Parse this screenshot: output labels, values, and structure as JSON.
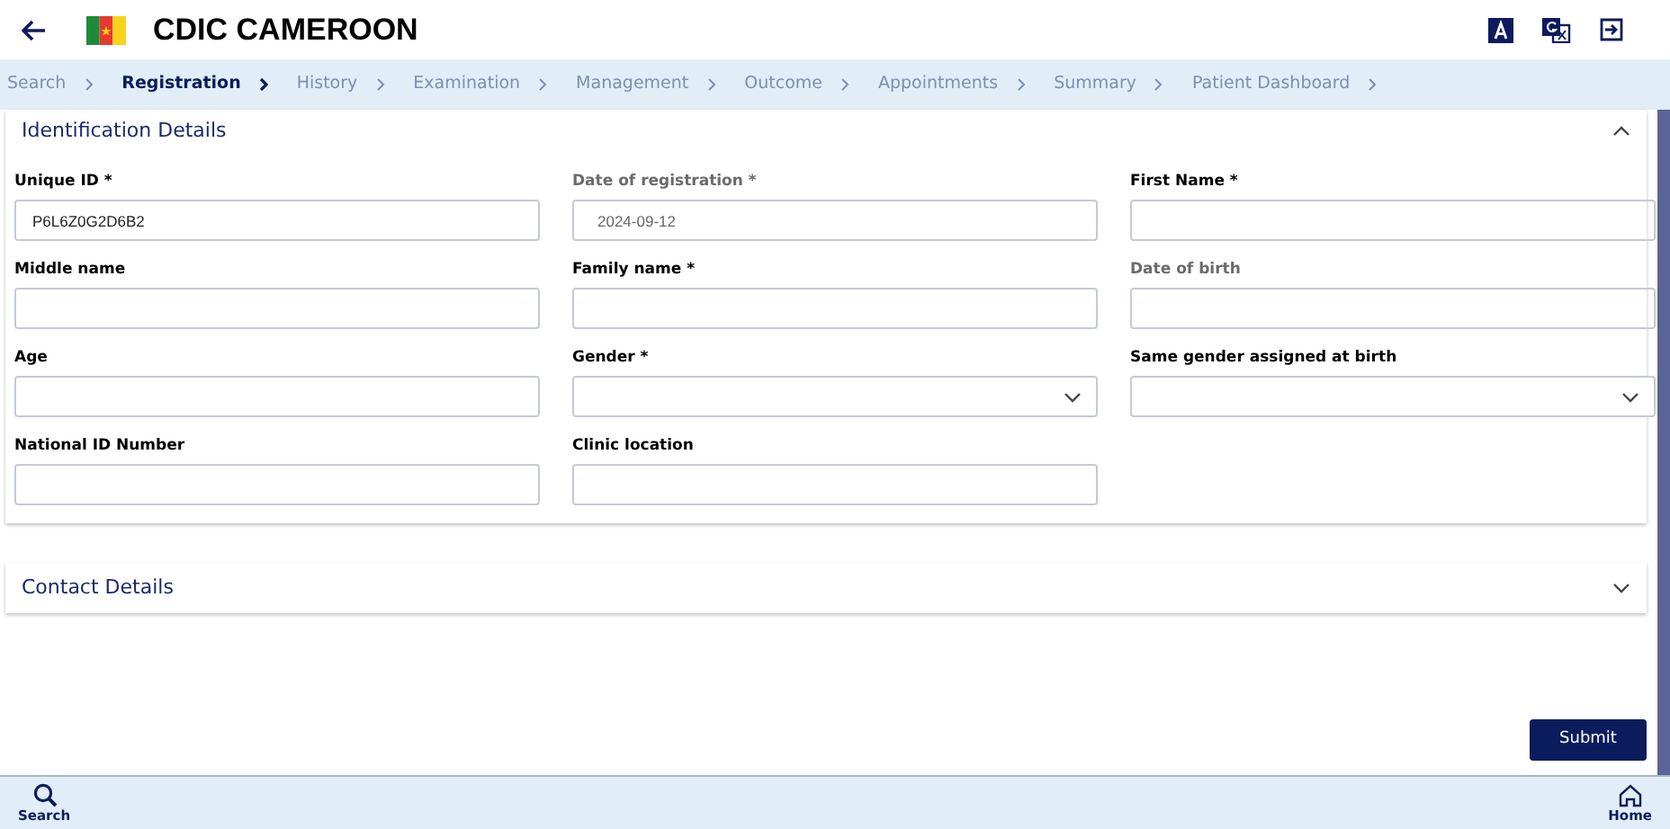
{
  "app_bar": {
    "title": "CDIC CAMEROON"
  },
  "breadcrumbs": [
    {
      "label": "Search",
      "selected": false
    },
    {
      "label": "Registration",
      "selected": true
    },
    {
      "label": "History",
      "selected": false
    },
    {
      "label": "Examination",
      "selected": false
    },
    {
      "label": "Management",
      "selected": false
    },
    {
      "label": "Outcome",
      "selected": false
    },
    {
      "label": "Appointments",
      "selected": false
    },
    {
      "label": "Summary",
      "selected": false
    },
    {
      "label": "Patient Dashboard",
      "selected": false
    }
  ],
  "sections": [
    {
      "title": "Identification Details",
      "expanded": true,
      "fields": [
        {
          "label": "Unique ID *",
          "kind": "text",
          "value": "P6L6Z0G2D6B2",
          "disabled": false
        },
        {
          "label": "Date of registration *",
          "kind": "text",
          "value": "2024-09-12",
          "disabled": true
        },
        {
          "label": "First Name *",
          "kind": "text",
          "disabled": false
        },
        {
          "label": "Middle name",
          "kind": "text",
          "disabled": false
        },
        {
          "label": "Family name *",
          "kind": "text",
          "disabled": false
        },
        {
          "label": "Date of birth",
          "kind": "text",
          "disabled": true
        },
        {
          "label": "Age",
          "kind": "text",
          "disabled": false
        },
        {
          "label": "Gender *",
          "kind": "select",
          "disabled": false
        },
        {
          "label": "Same gender assigned at birth",
          "kind": "select",
          "disabled": false
        },
        {
          "label": "National ID Number",
          "kind": "text",
          "disabled": false
        },
        {
          "label": "Clinic location",
          "kind": "text",
          "disabled": false
        }
      ]
    },
    {
      "title": "Contact Details",
      "expanded": false
    }
  ],
  "submit_button": "Submit",
  "bottom_nav": [
    {
      "label": "Search",
      "kind": "search"
    },
    {
      "label": "Home",
      "kind": "home"
    }
  ]
}
